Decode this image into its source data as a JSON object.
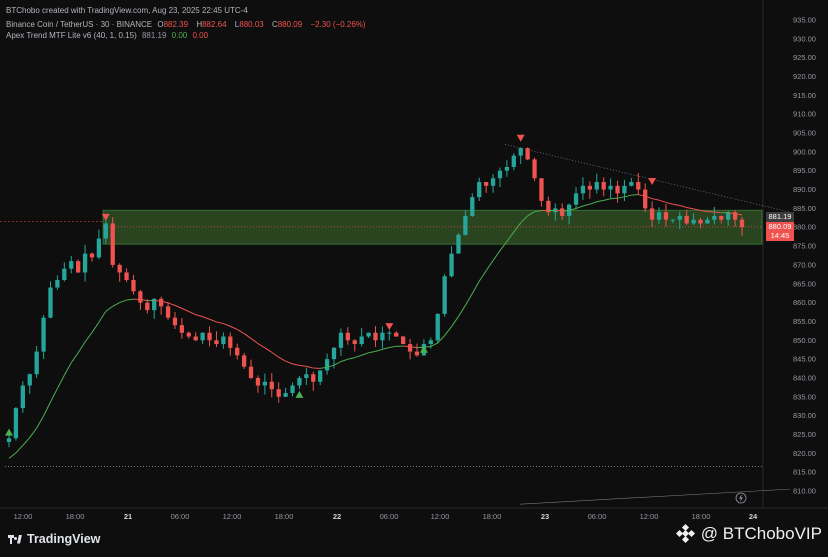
{
  "header": {
    "credit": "BTChobo created with TradingView.com, Aug 23, 2025 22:45 UTC-4",
    "symbol": "Binance Coin / TetherUS · 30 · BINANCE",
    "o_label": "O",
    "o_value": "882.39",
    "h_label": "H",
    "h_value": "882.64",
    "l_label": "L",
    "l_value": "880.03",
    "c_label": "C",
    "c_value": "880.09",
    "change": "−2.30 (−0.26%)",
    "indicator": "Apex Trend MTF Lite v6 (40, 1, 0.15)",
    "ind_v1": "881.19",
    "ind_v2": "0.00",
    "ind_v3": "0.00"
  },
  "badges": {
    "indicator_price": "881.19",
    "last_price": "880.09",
    "countdown": "14:45"
  },
  "footer": {
    "logo_text": "TradingView",
    "watermark": "@ BTChoboVIP"
  },
  "colors": {
    "up": "#26a69a",
    "down": "#ef5350",
    "zone": "#2e4d22",
    "trend_up": "#4caf50",
    "trend_down": "#ef5350"
  },
  "icons": [
    "tradingview-logo-icon",
    "binance-diamond-icon",
    "lightning-icon",
    "triangle-up-icon",
    "triangle-down-icon"
  ],
  "chart_data": {
    "type": "candlestick",
    "symbol": "Binance Coin / TetherUS",
    "interval": "30",
    "exchange": "BINANCE",
    "ylim": [
      808,
      936
    ],
    "y_ticks": [
      810,
      815,
      820,
      825,
      830,
      835,
      840,
      845,
      850,
      855,
      860,
      865,
      870,
      875,
      880,
      885,
      890,
      895,
      900,
      905,
      910,
      915,
      920,
      925,
      930,
      935
    ],
    "x_ticks": [
      {
        "label": "12:00",
        "bold": false
      },
      {
        "label": "18:00",
        "bold": false
      },
      {
        "label": "21",
        "bold": true
      },
      {
        "label": "06:00",
        "bold": false
      },
      {
        "label": "12:00",
        "bold": false
      },
      {
        "label": "18:00",
        "bold": false
      },
      {
        "label": "22",
        "bold": true
      },
      {
        "label": "06:00",
        "bold": false
      },
      {
        "label": "12:00",
        "bold": false
      },
      {
        "label": "18:00",
        "bold": false
      },
      {
        "label": "23",
        "bold": true
      },
      {
        "label": "06:00",
        "bold": false
      },
      {
        "label": "12:00",
        "bold": false
      },
      {
        "label": "18:00",
        "bold": false
      },
      {
        "label": "24",
        "bold": true
      }
    ],
    "zone": {
      "low": 875.5,
      "high": 884.5
    },
    "last_price": 880.09,
    "ohlc_last": {
      "open": 882.39,
      "high": 882.64,
      "low": 880.03,
      "close": 880.09
    },
    "close_path": [
      824,
      832,
      838,
      841,
      847,
      856,
      864,
      866,
      869,
      871,
      868,
      873,
      872,
      877,
      881,
      870,
      868,
      866,
      863,
      860,
      858,
      861,
      859,
      856,
      854,
      852,
      851,
      850,
      852,
      850,
      849,
      851,
      848,
      846,
      843,
      840,
      838,
      839,
      837,
      835,
      836,
      838,
      840,
      841,
      839,
      842,
      845,
      848,
      852,
      850,
      849,
      851,
      852,
      850,
      852,
      852,
      851,
      849,
      847,
      846,
      849,
      850,
      857,
      867,
      873,
      878,
      883,
      888,
      892,
      891,
      893,
      895,
      896,
      899,
      901,
      898,
      893,
      887,
      884,
      885,
      883,
      886,
      889,
      891,
      890,
      892,
      890,
      891,
      889,
      891,
      892,
      890,
      885,
      882,
      884,
      882,
      882,
      883,
      881,
      882,
      881,
      882,
      883,
      882,
      884,
      882,
      880
    ],
    "trend_signals": [
      {
        "type": "buy",
        "price": 825.5
      },
      {
        "type": "sell",
        "price": 882.5
      },
      {
        "type": "buy",
        "price": 835.5
      },
      {
        "type": "sell",
        "price": 853.5
      },
      {
        "type": "buy",
        "price": 847.5
      },
      {
        "type": "sell",
        "price": 903.5
      },
      {
        "type": "sell",
        "price": 892
      }
    ],
    "horizontal_lines": [
      816.5
    ]
  }
}
